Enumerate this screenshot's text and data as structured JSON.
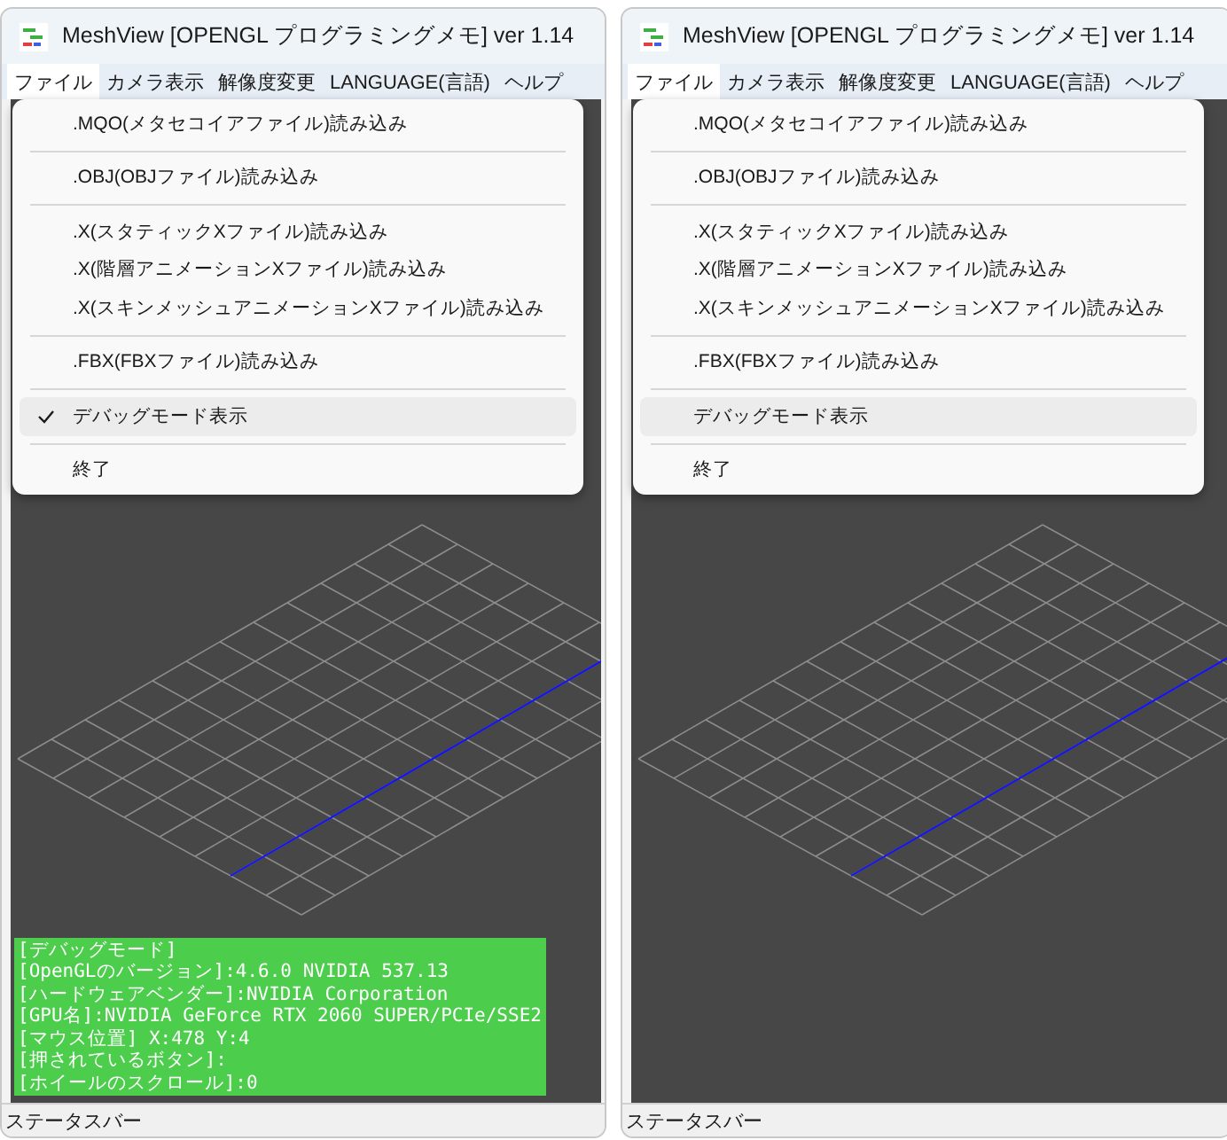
{
  "windows": [
    {
      "title": "MeshView [OPENGL プログラミングメモ] ver 1.14",
      "menu": [
        {
          "label": "ファイル",
          "selected": true
        },
        {
          "label": "カメラ表示",
          "selected": false
        },
        {
          "label": "解像度変更",
          "selected": false
        },
        {
          "label": "LANGUAGE(言語)",
          "selected": false
        },
        {
          "label": "ヘルプ",
          "selected": false
        }
      ],
      "dropdown": [
        {
          "kind": "item",
          "label": ".MQO(メタセコイアファイル)読み込み",
          "checked": false,
          "highlighted": false
        },
        {
          "kind": "separator"
        },
        {
          "kind": "item",
          "label": ".OBJ(OBJファイル)読み込み",
          "checked": false,
          "highlighted": false
        },
        {
          "kind": "separator"
        },
        {
          "kind": "item",
          "label": ".X(スタティックXファイル)読み込み",
          "checked": false,
          "highlighted": false
        },
        {
          "kind": "item",
          "label": ".X(階層アニメーションXファイル)読み込み",
          "checked": false,
          "highlighted": false
        },
        {
          "kind": "item",
          "label": ".X(スキンメッシュアニメーションXファイル)読み込み",
          "checked": false,
          "highlighted": false
        },
        {
          "kind": "separator"
        },
        {
          "kind": "item",
          "label": ".FBX(FBXファイル)読み込み",
          "checked": false,
          "highlighted": false
        },
        {
          "kind": "separator"
        },
        {
          "kind": "item",
          "label": "デバッグモード表示",
          "checked": true,
          "highlighted": true
        },
        {
          "kind": "separator"
        },
        {
          "kind": "item",
          "label": "終了",
          "checked": false,
          "highlighted": false
        }
      ],
      "debug_panel": {
        "lines": [
          "[デバッグモード]",
          "[OpenGLのバージョン]:4.6.0 NVIDIA 537.13",
          "[ハードウェアベンダー]:NVIDIA Corporation",
          "[GPU名]:NVIDIA GeForce RTX 2060 SUPER/PCIe/SSE2",
          "[マウス位置] X:478 Y:4",
          "[押されているボタン]:",
          "[ホイールのスクロール]:0"
        ]
      },
      "status_bar": "ステータスバー"
    },
    {
      "title": "MeshView [OPENGL プログラミングメモ] ver 1.14",
      "menu": [
        {
          "label": "ファイル",
          "selected": true
        },
        {
          "label": "カメラ表示",
          "selected": false
        },
        {
          "label": "解像度変更",
          "selected": false
        },
        {
          "label": "LANGUAGE(言語)",
          "selected": false
        },
        {
          "label": "ヘルプ",
          "selected": false
        }
      ],
      "dropdown": [
        {
          "kind": "item",
          "label": ".MQO(メタセコイアファイル)読み込み",
          "checked": false,
          "highlighted": false
        },
        {
          "kind": "separator"
        },
        {
          "kind": "item",
          "label": ".OBJ(OBJファイル)読み込み",
          "checked": false,
          "highlighted": false
        },
        {
          "kind": "separator"
        },
        {
          "kind": "item",
          "label": ".X(スタティックXファイル)読み込み",
          "checked": false,
          "highlighted": false
        },
        {
          "kind": "item",
          "label": ".X(階層アニメーションXファイル)読み込み",
          "checked": false,
          "highlighted": false
        },
        {
          "kind": "item",
          "label": ".X(スキンメッシュアニメーションXファイル)読み込み",
          "checked": false,
          "highlighted": false
        },
        {
          "kind": "separator"
        },
        {
          "kind": "item",
          "label": ".FBX(FBXファイル)読み込み",
          "checked": false,
          "highlighted": false
        },
        {
          "kind": "separator"
        },
        {
          "kind": "item",
          "label": "デバッグモード表示",
          "checked": false,
          "highlighted": true
        },
        {
          "kind": "separator"
        },
        {
          "kind": "item",
          "label": "終了",
          "checked": false,
          "highlighted": false
        }
      ],
      "status_bar": "ステータスバー"
    }
  ]
}
